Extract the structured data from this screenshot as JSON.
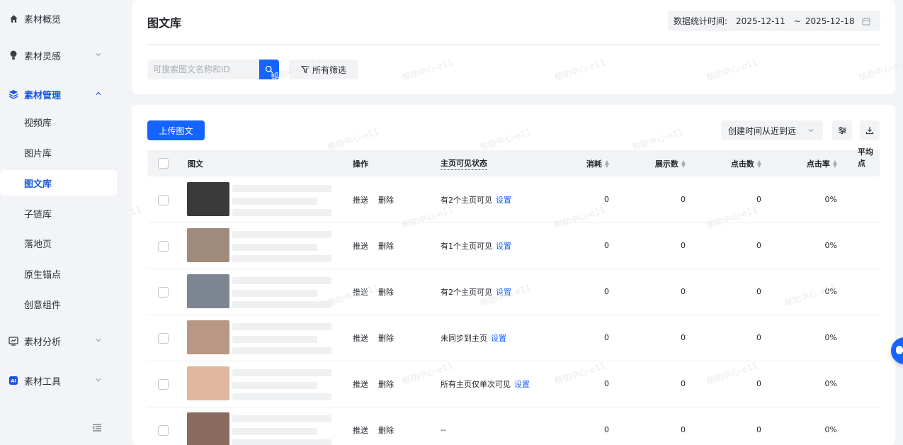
{
  "sidebar": {
    "groups": [
      {
        "label": "素材概览",
        "icon": "home-icon"
      },
      {
        "label": "素材灵感",
        "icon": "bulb-icon"
      },
      {
        "label": "素材管理",
        "icon": "layers-icon"
      },
      {
        "label": "素材分析",
        "icon": "analytics-icon"
      },
      {
        "label": "素材工具",
        "icon": "ai-icon"
      }
    ],
    "sub_items": [
      "视频库",
      "图片库",
      "图文库",
      "子链库",
      "落地页",
      "原生锚点",
      "创意组件"
    ],
    "active_sub": "图文库"
  },
  "header": {
    "title": "图文库",
    "date_label": "数据统计时间:",
    "date_start": "2025-12-11",
    "date_sep": "~",
    "date_end": "2025-12-18"
  },
  "filters": {
    "search_placeholder": "可搜索图文名称和ID",
    "filter_label": "所有筛选"
  },
  "toolbar": {
    "upload_label": "上传图文",
    "sort_label": "创建时间从近到远"
  },
  "table": {
    "columns": {
      "content": "图文",
      "actions": "操作",
      "visibility": "主页可见状态",
      "cost": "消耗",
      "impressions": "展示数",
      "clicks": "点击数",
      "ctr": "点击率",
      "avg": "平均点"
    },
    "push_label": "推送",
    "delete_label": "删除",
    "setting_label": "设置",
    "rows": [
      {
        "visibility": "有2个主页可见",
        "cost": "0",
        "impressions": "0",
        "clicks": "0",
        "ctr": "0%",
        "thumb": "#3a3a3a"
      },
      {
        "visibility": "有1个主页可见",
        "cost": "0",
        "impressions": "0",
        "clicks": "0",
        "ctr": "0%",
        "thumb": "#a08a7c"
      },
      {
        "visibility": "有2个主页可见",
        "cost": "0",
        "impressions": "0",
        "clicks": "0",
        "ctr": "0%",
        "thumb": "#7d8690"
      },
      {
        "visibility": "未同步到主页",
        "cost": "0",
        "impressions": "0",
        "clicks": "0",
        "ctr": "0%",
        "thumb": "#b89784"
      },
      {
        "visibility": "所有主页仅单次可见",
        "cost": "0",
        "impressions": "0",
        "clicks": "0",
        "ctr": "0%",
        "thumb": "#e1b79f"
      },
      {
        "visibility": "--",
        "cost": "0",
        "impressions": "0",
        "clicks": "0",
        "ctr": "0%",
        "thumb": "#8a6a5e"
      }
    ]
  },
  "watermark": "帮助中心-e11",
  "colors": {
    "primary": "#1664ff",
    "link": "#1664ff",
    "active_nav": "#1a56db"
  }
}
